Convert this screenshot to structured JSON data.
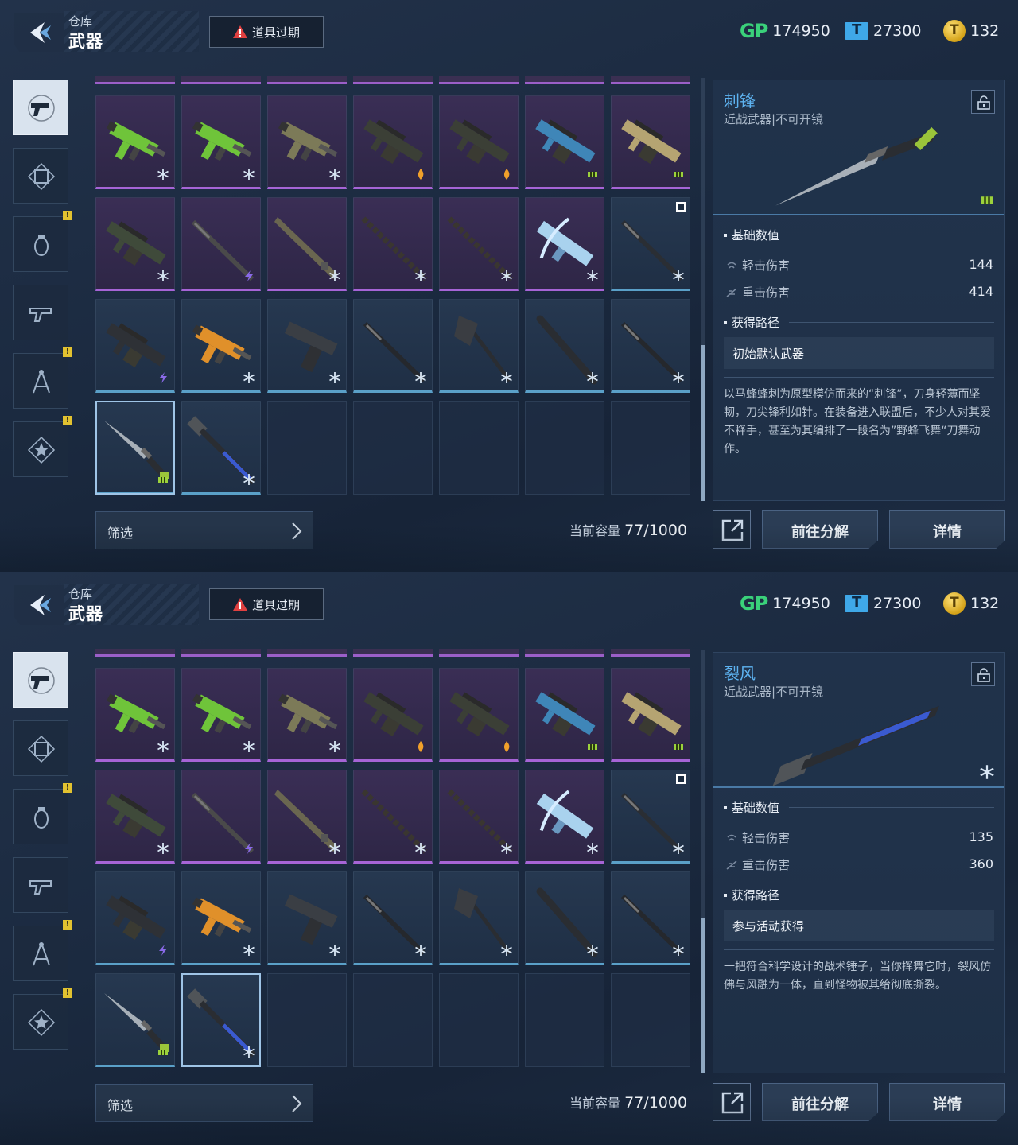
{
  "panels": [
    {
      "header": {
        "section": "仓库",
        "title": "武器",
        "expire_button": "道具过期"
      },
      "currency": {
        "gp_label": "GP",
        "gp": "174950",
        "tickets": "27300",
        "coins": "132"
      },
      "filter_label": "筛选",
      "capacity": {
        "label": "当前容量",
        "used": "77",
        "total": "/1000"
      },
      "selected_index": 21,
      "detail": {
        "name": "刺锋",
        "subtitle": "近战武器|不可开镜",
        "weapon_icon": "knife-icon",
        "stats_heading": "基础数值",
        "stats": [
          {
            "icon": "light-attack-icon",
            "label": "轻击伤害",
            "value": "144"
          },
          {
            "icon": "heavy-attack-icon",
            "label": "重击伤害",
            "value": "414"
          }
        ],
        "source_heading": "获得路径",
        "source": "初始默认武器",
        "description": "以马蜂蜂刺为原型模仿而来的“刺锋”，刀身轻薄而坚韧，刀尖锋利如针。在装备进入联盟后，不少人对其爱不释手，甚至为其编排了一段名为”野蜂飞舞“刀舞动作。"
      },
      "buttons": {
        "decompose": "前往分解",
        "details": "详情"
      }
    },
    {
      "header": {
        "section": "仓库",
        "title": "武器",
        "expire_button": "道具过期"
      },
      "currency": {
        "gp_label": "GP",
        "gp": "174950",
        "tickets": "27300",
        "coins": "132"
      },
      "filter_label": "筛选",
      "capacity": {
        "label": "当前容量",
        "used": "77",
        "total": "/1000"
      },
      "selected_index": 22,
      "detail": {
        "name": "裂风",
        "subtitle": "近战武器|不可开镜",
        "weapon_icon": "hammer-icon",
        "stats_heading": "基础数值",
        "stats": [
          {
            "icon": "light-attack-icon",
            "label": "轻击伤害",
            "value": "135"
          },
          {
            "icon": "heavy-attack-icon",
            "label": "重击伤害",
            "value": "360"
          }
        ],
        "source_heading": "获得路径",
        "source": "参与活动获得",
        "description": "一把符合科学设计的战术锤子，当你挥舞它时，裂风仿佛与风融为一体，直到怪物被其给彻底撕裂。"
      },
      "buttons": {
        "decompose": "前往分解",
        "details": "详情"
      }
    }
  ],
  "grid_items": [
    {
      "rarity": "purple",
      "icon": "smg-icon",
      "color": "#6fc43a",
      "tier": "snowflake-icon"
    },
    {
      "rarity": "purple",
      "icon": "smg-icon",
      "color": "#6fc43a",
      "tier": "snowflake-icon"
    },
    {
      "rarity": "purple",
      "icon": "smg-icon",
      "color": "#7c7a58",
      "tier": "snowflake-icon"
    },
    {
      "rarity": "purple",
      "icon": "rifle-icon",
      "color": "#3b3f36",
      "tier": "flame-icon"
    },
    {
      "rarity": "purple",
      "icon": "rifle-icon",
      "color": "#3b3f36",
      "tier": "flame-icon"
    },
    {
      "rarity": "purple",
      "icon": "rifle-icon",
      "color": "#3f86b8",
      "tier": "wasp-icon"
    },
    {
      "rarity": "purple",
      "icon": "rifle-icon",
      "color": "#b5a472",
      "tier": "wasp-icon"
    },
    {
      "rarity": "purple",
      "icon": "rifle-icon",
      "color": "#3f4a3a",
      "tier": "snowflake-icon"
    },
    {
      "rarity": "purple",
      "icon": "rod-icon",
      "color": "#4a4a4a",
      "tier": "bolt-icon"
    },
    {
      "rarity": "purple",
      "icon": "blade-icon",
      "color": "#6a6650",
      "tier": "snowflake-icon"
    },
    {
      "rarity": "purple",
      "icon": "chain-icon",
      "color": "#3a3630",
      "tier": "snowflake-icon"
    },
    {
      "rarity": "purple",
      "icon": "chain-icon",
      "color": "#3a3630",
      "tier": "snowflake-icon"
    },
    {
      "rarity": "purple",
      "icon": "crossbow-icon",
      "color": "#a9d2ee",
      "tier": "snowflake-icon"
    },
    {
      "rarity": "blue",
      "icon": "rod-icon",
      "color": "#2a2e34",
      "tier": "snowflake-icon",
      "marked": true
    },
    {
      "rarity": "blue",
      "icon": "rifle-icon",
      "color": "#2e3136",
      "tier": "bolt-icon"
    },
    {
      "rarity": "blue",
      "icon": "smg-icon",
      "color": "#e0902a",
      "tier": "snowflake-icon"
    },
    {
      "rarity": "blue",
      "icon": "pistol-icon",
      "color": "#3a3e44",
      "tier": "snowflake-icon"
    },
    {
      "rarity": "blue",
      "icon": "rod-icon",
      "color": "#25282d",
      "tier": "snowflake-icon"
    },
    {
      "rarity": "blue",
      "icon": "axe-icon",
      "color": "#2a2d32",
      "tier": "snowflake-icon"
    },
    {
      "rarity": "blue",
      "icon": "bat-icon",
      "color": "#2a2d32",
      "tier": "snowflake-icon"
    },
    {
      "rarity": "blue",
      "icon": "rod-icon",
      "color": "#25282d",
      "tier": "snowflake-icon"
    },
    {
      "rarity": "blue",
      "icon": "knife-icon",
      "color": "#4a4e54",
      "tier": "wasp-icon"
    },
    {
      "rarity": "blue",
      "icon": "hammer-icon",
      "color": "#3a5ad0",
      "tier": "snowflake-icon"
    },
    {
      "rarity": "empty"
    },
    {
      "rarity": "empty"
    },
    {
      "rarity": "empty"
    },
    {
      "rarity": "empty"
    },
    {
      "rarity": "empty"
    }
  ],
  "rail": [
    {
      "icon": "pistol-icon",
      "active": true,
      "badge": false
    },
    {
      "icon": "frame-icon",
      "active": false,
      "badge": false
    },
    {
      "icon": "grenade-icon",
      "active": false,
      "badge": true
    },
    {
      "icon": "gear-gun-icon",
      "active": false,
      "badge": false
    },
    {
      "icon": "compass-icon",
      "active": false,
      "badge": true
    },
    {
      "icon": "star-badge-icon",
      "active": false,
      "badge": true
    }
  ],
  "colors": {
    "accent": "#5db2f0",
    "purple_rarity": "#a664d6",
    "blue_rarity": "#5aa0c8",
    "gp": "#3ad17a",
    "badge": "#e2c230"
  }
}
